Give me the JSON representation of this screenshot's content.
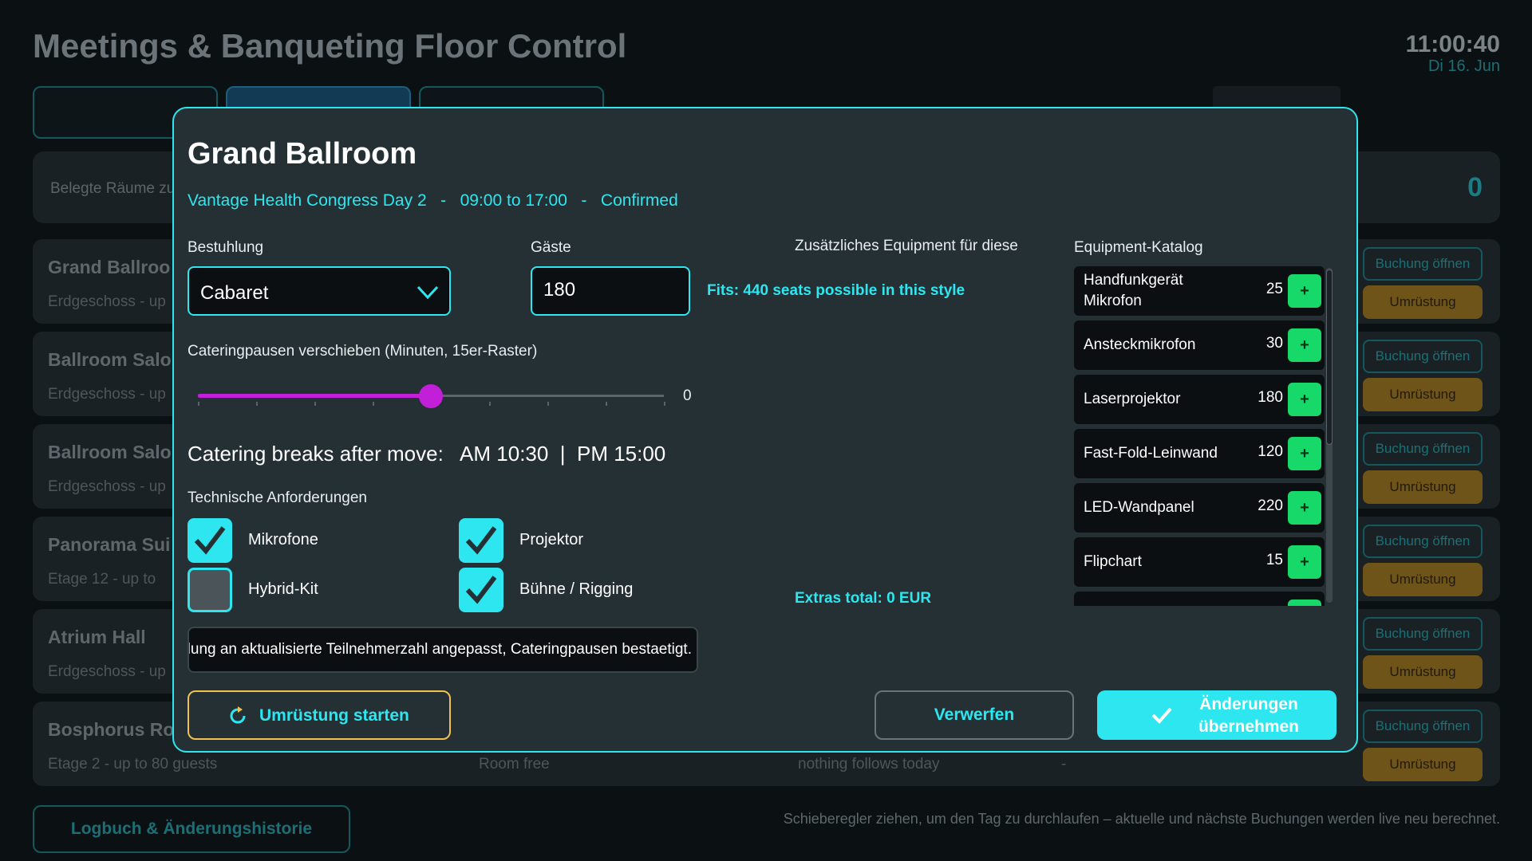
{
  "app": {
    "title": "Meetings & Banqueting Floor Control",
    "time": "11:00:40",
    "date": "Di 16. Jun"
  },
  "summary": {
    "label": "Belegte Räume zu",
    "count": "0"
  },
  "rooms": [
    {
      "name": "Grand Ballroo",
      "meta": "Erdgeschoss  -  up",
      "status": "",
      "next": "",
      "dash": "",
      "open_label": "Buchung öffnen",
      "convert_label": "Umrüstung"
    },
    {
      "name": "Ballroom Salo",
      "meta": "Erdgeschoss  -  up",
      "status": "",
      "next": "",
      "dash": "",
      "open_label": "Buchung öffnen",
      "convert_label": "Umrüstung"
    },
    {
      "name": "Ballroom Salo",
      "meta": "Erdgeschoss  -  up",
      "status": "",
      "next": "",
      "dash": "",
      "open_label": "Buchung öffnen",
      "convert_label": "Umrüstung"
    },
    {
      "name": "Panorama Sui",
      "meta": "Etage 12  -  up to",
      "status": "",
      "next": "",
      "dash": "",
      "open_label": "Buchung öffnen",
      "convert_label": "Umrüstung"
    },
    {
      "name": "Atrium Hall",
      "meta": "Erdgeschoss  -  up",
      "status": "",
      "next": "",
      "dash": "",
      "open_label": "Buchung öffnen",
      "convert_label": "Umrüstung"
    },
    {
      "name": "Bosphorus Ro",
      "meta": "Etage 2  -  up to 80 guests",
      "status": "Room free",
      "next": "nothing follows today",
      "dash": "-",
      "open_label": "Buchung öffnen",
      "convert_label": "Umrüstung"
    }
  ],
  "footer": {
    "logbook_label": "Logbuch & Änderungshistorie",
    "hint": "Schieberegler ziehen, um den Tag zu durchlaufen – aktuelle und nächste Buchungen werden live neu berechnet."
  },
  "modal": {
    "title": "Grand Ballroom",
    "subtitle": "Vantage Health Congress Day 2   -   09:00 to 17:00   -   Confirmed",
    "seating_label": "Bestuhlung",
    "seating_value": "Cabaret",
    "guests_label": "Gäste",
    "guests_value": "180",
    "fits_text": "Fits: 440 seats possible in this style",
    "slider_label": "Cateringpausen verschieben (Minuten, 15er-Raster)",
    "slider": {
      "value": 0,
      "min": -120,
      "max": 120,
      "position_fraction": 0.5
    },
    "slider_value_text": "0",
    "breaks_text": "Catering breaks after move:   AM 10:30  |  PM 15:00",
    "tech_label": "Technische Anforderungen",
    "tech": [
      {
        "label": "Mikrofone",
        "checked": true
      },
      {
        "label": "Projektor",
        "checked": true
      },
      {
        "label": "Hybrid-Kit",
        "checked": false
      },
      {
        "label": "Bühne / Rigging",
        "checked": true
      }
    ],
    "notes_value": "Bestuhlung an aktualisierte Teilnehmerzahl angepasst, Cateringpausen bestaetigt.",
    "extras_label": "Zusätzliches Equipment für diese Buchung",
    "extras_total": "Extras total: 0 EUR",
    "catalog_label": "Equipment-Katalog",
    "catalog": [
      {
        "name": "Handfunkgerät Mikrofon",
        "price": "25",
        "add": "+"
      },
      {
        "name": "Ansteckmikrofon",
        "price": "30",
        "add": "+"
      },
      {
        "name": "Laserprojektor",
        "price": "180",
        "add": "+"
      },
      {
        "name": "Fast-Fold-Leinwand",
        "price": "120",
        "add": "+"
      },
      {
        "name": "LED-Wandpanel",
        "price": "220",
        "add": "+"
      },
      {
        "name": "Flipchart",
        "price": "15",
        "add": "+"
      },
      {
        "name": "",
        "price": "",
        "add": ""
      }
    ],
    "btn_convert": "Umrüstung starten",
    "btn_discard": "Verwerfen",
    "btn_apply": "Änderungen übernehmen"
  },
  "colors": {
    "accent": "#2ee6ef",
    "slider": "#c21fd8",
    "add": "#17d96a",
    "warning_border": "#f0c24d"
  },
  "icons": {
    "seating_chevron": "chevron-down-icon",
    "convert": "refresh-icon",
    "apply": "check-icon"
  }
}
